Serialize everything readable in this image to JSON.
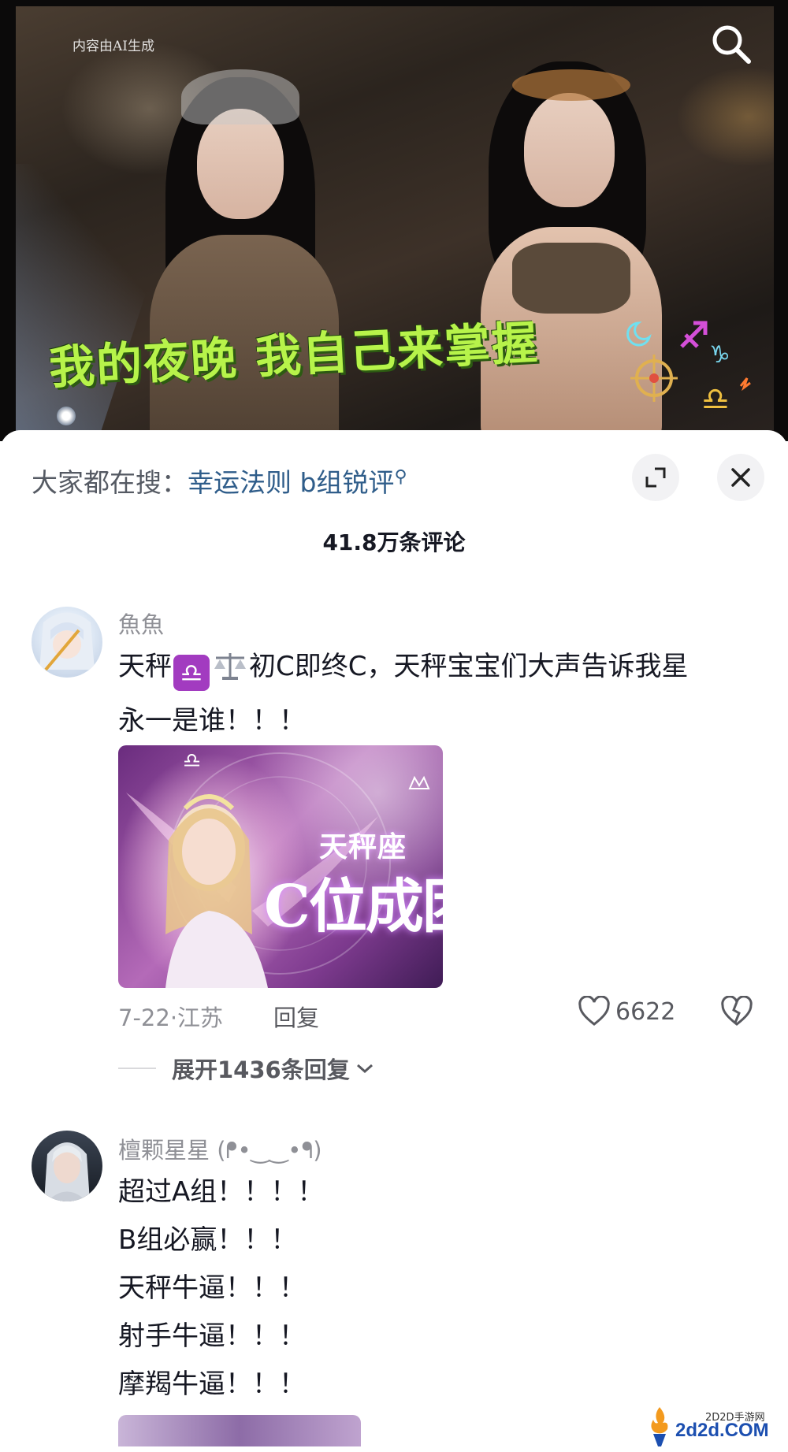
{
  "video": {
    "ai_label": "内容由AI生成",
    "caption": "我的夜晚 我自己来掌握",
    "search_icon": "search-icon"
  },
  "sheet": {
    "search_prefix": "大家都在搜：",
    "search_query": "幸运法则 b组锐评",
    "expand_icon": "expand-icon",
    "close_icon": "close-icon",
    "comment_count": "41.8万条评论"
  },
  "comments": [
    {
      "username": "魚魚",
      "text_before_badge": "天秤",
      "badge": "♎",
      "scale": "⚖️",
      "text_after": "初C即终C，天秤宝宝们大声告诉我星",
      "text_line2": "永一是谁！！！",
      "image_title_small": "天秤座",
      "image_title_large": "C位成团",
      "date": "7-22",
      "location": "江苏",
      "reply_label": "回复",
      "like_count": "6622",
      "expand_label": "展开1436条回复"
    },
    {
      "username": "檀颗星星 (ᖰ•‿‿•ᖳ)",
      "lines": [
        "超过A组！！！！",
        "B组必赢！！！",
        "天秤牛逼！！！",
        "射手牛逼！！！",
        "摩羯牛逼！！！"
      ]
    }
  ],
  "watermark": {
    "site_cn": "2D2D手游网",
    "site_en": "2d2d.COM"
  },
  "colors": {
    "caption_green": "#b7f34a",
    "link_blue": "#2f5d8a",
    "libra_purple": "#a23bc0"
  }
}
